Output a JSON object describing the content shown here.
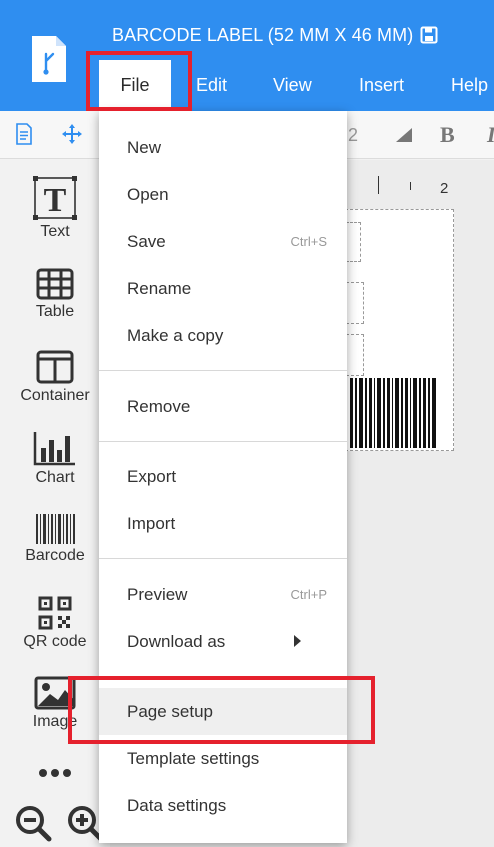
{
  "header": {
    "title": "BARCODE LABEL (52 MM X 46 MM)",
    "menu": [
      "File",
      "Edit",
      "View",
      "Insert",
      "Help"
    ],
    "active_menu": "File"
  },
  "toolbar": {
    "font_size_fragment": "2",
    "bold_label": "B",
    "italic_label": "I"
  },
  "tools": [
    {
      "label": "Text",
      "icon": "text-icon"
    },
    {
      "label": "Table",
      "icon": "table-icon"
    },
    {
      "label": "Container",
      "icon": "container-icon"
    },
    {
      "label": "Chart",
      "icon": "chart-icon"
    },
    {
      "label": "Barcode",
      "icon": "barcode-icon"
    },
    {
      "label": "QR code",
      "icon": "qr-code-icon"
    },
    {
      "label": "Image",
      "icon": "image-icon"
    }
  ],
  "ruler": {
    "mark": "2"
  },
  "file_menu": {
    "items": [
      {
        "label": "New",
        "shortcut": ""
      },
      {
        "label": "Open",
        "shortcut": ""
      },
      {
        "label": "Save",
        "shortcut": "Ctrl+S"
      },
      {
        "label": "Rename",
        "shortcut": ""
      },
      {
        "label": "Make a copy",
        "shortcut": ""
      },
      {
        "label": "Remove",
        "shortcut": ""
      },
      {
        "label": "Export",
        "shortcut": ""
      },
      {
        "label": "Import",
        "shortcut": ""
      },
      {
        "label": "Preview",
        "shortcut": "Ctrl+P"
      },
      {
        "label": "Download as",
        "shortcut": "",
        "submenu": true
      },
      {
        "label": "Page setup",
        "shortcut": "",
        "highlighted": true
      },
      {
        "label": "Template settings",
        "shortcut": ""
      },
      {
        "label": "Data settings",
        "shortcut": ""
      }
    ]
  },
  "colors": {
    "header_bg": "#2f8ef0",
    "highlight_box": "#e5212d"
  }
}
